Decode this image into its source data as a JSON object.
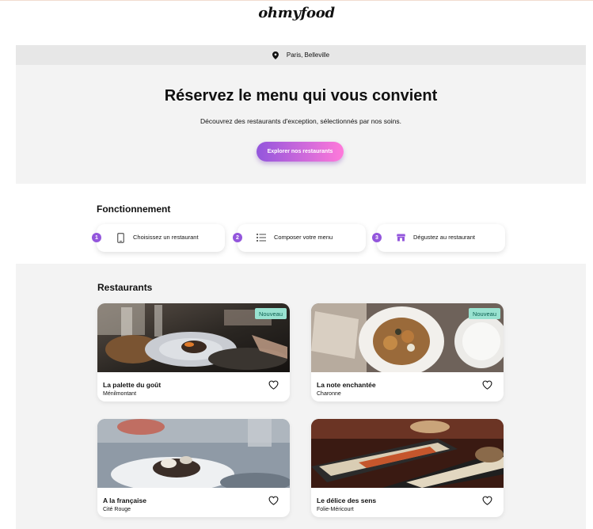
{
  "brand": {
    "logo": "ohmyfood"
  },
  "location": {
    "text": "Paris, Belleville",
    "icon": "map-pin-icon"
  },
  "hero": {
    "title": "Réservez le menu qui vous convient",
    "subtitle": "Découvrez des restaurants d'exception, sélectionnés par nos soins.",
    "cta_label": "Explorer nos restaurants"
  },
  "how_it_works": {
    "title": "Fonctionnement",
    "steps": [
      {
        "number": "1",
        "label": "Choisissez un restaurant",
        "icon": "mobile-phone-icon"
      },
      {
        "number": "2",
        "label": "Composer votre menu",
        "icon": "list-icon"
      },
      {
        "number": "3",
        "label": "Dégustez au restaurant",
        "icon": "store-icon"
      }
    ]
  },
  "restaurants": {
    "title": "Restaurants",
    "items": [
      {
        "name": "La palette du goût",
        "district": "Ménilmontant",
        "badge": "Nouveau",
        "favorite_icon": "heart-outline-icon"
      },
      {
        "name": "La note enchantée",
        "district": "Charonne",
        "badge": "Nouveau",
        "favorite_icon": "heart-outline-icon"
      },
      {
        "name": "A la française",
        "district": "Cité Rouge",
        "badge": "",
        "favorite_icon": "heart-outline-icon"
      },
      {
        "name": "Le délice des sens",
        "district": "Folie-Méricourt",
        "badge": "",
        "favorite_icon": "heart-outline-icon"
      }
    ]
  },
  "colors": {
    "accent_primary": "#9356DC",
    "accent_secondary": "#FF79DA",
    "badge_bg": "#99E2D0",
    "hero_bg": "#F3F3F3",
    "location_bg": "#E7E7E7"
  }
}
